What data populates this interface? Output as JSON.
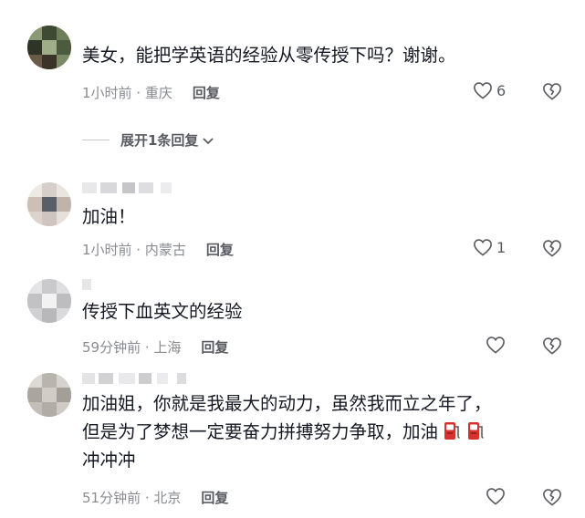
{
  "comments": [
    {
      "text_lines": [
        "美女，能把学英语的经验从零传授下吗？谢谢。"
      ],
      "time": "1小时前 · 重庆",
      "reply_label": "回复",
      "likes": "6",
      "has_expand": true,
      "expand_label": "展开1条回复"
    },
    {
      "text_lines": [
        "加油！"
      ],
      "time": "1小时前 · 内蒙古",
      "reply_label": "回复",
      "likes": "1"
    },
    {
      "text_lines": [
        "传授下血英文的经验"
      ],
      "time": "59分钟前 · 上海",
      "reply_label": "回复",
      "likes": ""
    },
    {
      "text_lines": [
        "加油姐，你就是我最大的动力，虽然我而立之年了，",
        "但是为了梦想一定要奋力拼搏努力争取，加油",
        "冲冲冲"
      ],
      "time": "51分钟前 · 北京",
      "reply_label": "回复",
      "likes": "",
      "emoji": "gas-pump-emoji"
    }
  ],
  "icons": {
    "like": "heart-outline-icon",
    "dislike": "broken-heart-icon",
    "expand": "chevron-down-icon"
  },
  "colors": {
    "text": "#161823",
    "meta": "#8a8b91",
    "action": "#5a5b61",
    "emoji_red": "#d9312f"
  }
}
